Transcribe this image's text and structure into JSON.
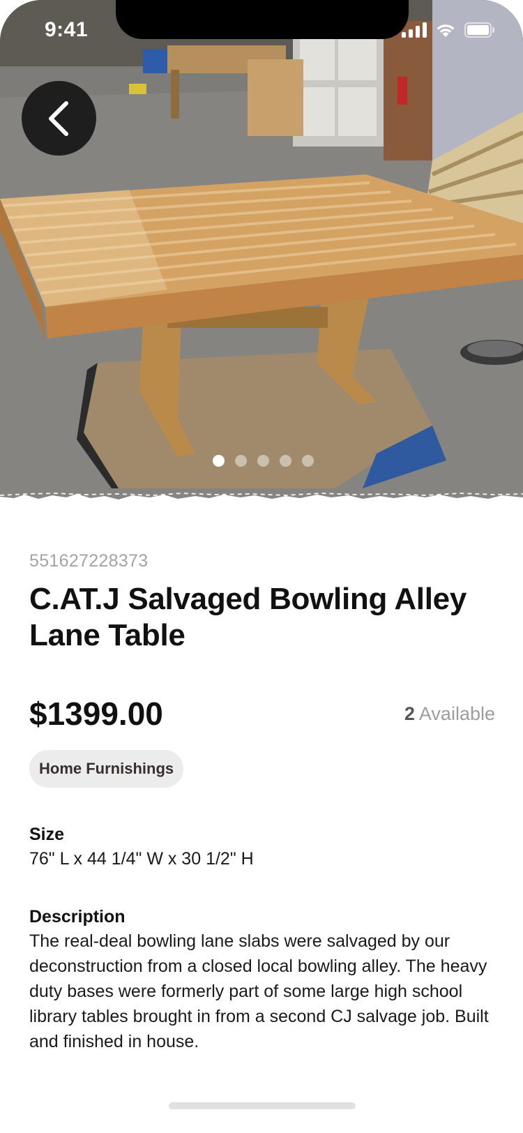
{
  "status_bar": {
    "time": "9:41",
    "icons": [
      "signal-icon",
      "wifi-icon",
      "battery-icon"
    ]
  },
  "hero": {
    "image_subject": "wooden bowling-lane table in warehouse",
    "pager": {
      "total": 5,
      "active_index": 0
    },
    "back_icon": "chevron-left-icon"
  },
  "product": {
    "sku": "551627228373",
    "title": "C.AT.J Salvaged Bowling Alley Lane Table",
    "price": "$1399.00",
    "available_count": "2",
    "available_label": "Available",
    "category": "Home Furnishings",
    "size_label": "Size",
    "size_value": "76\" L x 44 1/4\" W x 30 1/2\" H",
    "description_label": "Description",
    "description": "The real-deal bowling lane slabs were salvaged by our deconstruction from a closed local bowling alley. The heavy duty bases were formerly part of some large high school library tables brought in from a second CJ salvage job. Built and finished in house."
  },
  "colors": {
    "chip_bg": "#ececec",
    "muted_text": "#a3a3a3",
    "back_button_bg": "#161616"
  }
}
